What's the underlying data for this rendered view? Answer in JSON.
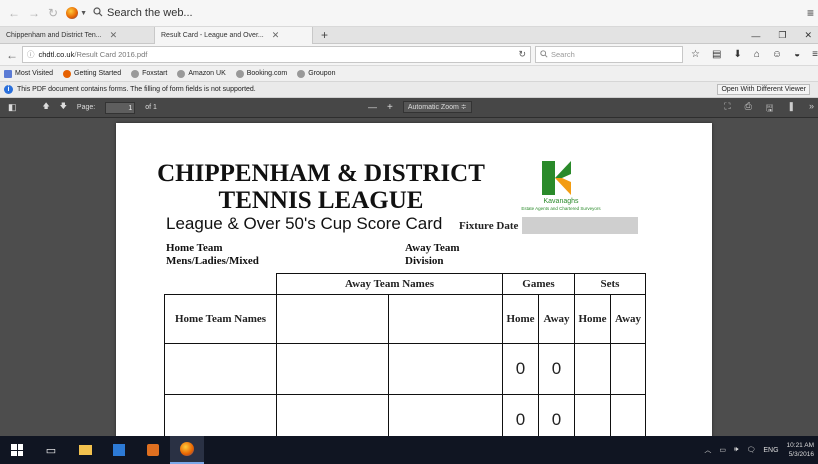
{
  "browser": {
    "search_placeholder": "Search the web...",
    "tabs": [
      {
        "label": "Chippenham and District Ten...",
        "close": "✕"
      },
      {
        "label": "Result Card - League and Over...",
        "close": "✕"
      }
    ],
    "new_tab": "+",
    "url_host": "chdtl.co.uk",
    "url_path": "/Result Card 2016.pdf",
    "search_box_placeholder": "Search",
    "bookmarks": [
      "Most Visited",
      "Getting Started",
      "Foxstart",
      "Amazon UK",
      "Booking.com",
      "Groupon"
    ],
    "notification": "This PDF document contains forms. The filling of form fields is not supported.",
    "open_viewer_button": "Open With Different Viewer"
  },
  "pdf_toolbar": {
    "page_label": "Page:",
    "page_value": "1",
    "page_total": "of 1",
    "zoom_out": "—",
    "zoom_in": "+",
    "zoom_value": "Automatic Zoom",
    "zoom_caret": "≑"
  },
  "document": {
    "title_line1": "CHIPPENHAM & DISTRICT",
    "title_line2": "TENNIS LEAGUE",
    "subtitle": "League & Over 50's Cup Score Card",
    "fixture_label": "Fixture Date",
    "logo_brand": "Kavanaghs",
    "logo_tagline": "Estate Agents and Chartered Surveyors",
    "home_team_label": "Home Team",
    "category_label": "Mens/Ladies/Mixed",
    "away_team_label": "Away Team",
    "division_label": "Division",
    "table": {
      "away_team_names_header": "Away Team Names",
      "games_header": "Games",
      "sets_header": "Sets",
      "home_team_names_header": "Home Team Names",
      "home_col": "Home",
      "away_col": "Away",
      "rows": [
        {
          "games_home": "0",
          "games_away": "0"
        },
        {
          "games_home": "0",
          "games_away": "0"
        }
      ]
    }
  },
  "taskbar": {
    "lang": "ENG",
    "time": "10:21 AM",
    "date": "5/3/2016"
  },
  "colors": {
    "logo_green": "#2a8a2a",
    "logo_orange": "#f39c12",
    "viewer_bg": "#4d4d4d",
    "pdf_toolbar_bg": "#474747",
    "taskbar_bg": "#101522"
  }
}
